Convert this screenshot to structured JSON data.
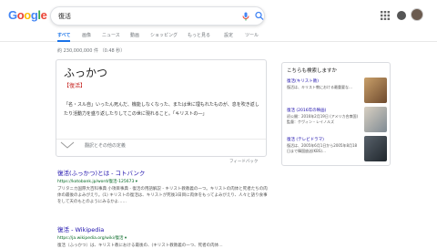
{
  "logo": {
    "text": "Google"
  },
  "search": {
    "value": "復活"
  },
  "tabs": [
    "すべて",
    "画像",
    "ニュース",
    "動画",
    "ショッピング",
    "もっと見る",
    "設定",
    "ツール"
  ],
  "stats": "約 230,000,000 件 （0.48 秒）",
  "dict": {
    "term": "ふっかつ",
    "tag": "【復活】",
    "definition": "「名・スル自」いったん死んだ、機能しなくなった、または世に埋もれたものが、息を吹き返したり活動力を盛り返したりしてこの世に現れること。「キリストの―」",
    "origin": "翻訳とその他の定義"
  },
  "feedback": "フィードバック",
  "results": [
    {
      "title": "復活(ふっかつ)とは - コトバンク",
      "url": "https://kotobank.jp/word/復活-125673 ▾",
      "snippet": "ブリタニカ国際大百科事典 小項目事典 - 復活の用語解説 - キリスト教教義の一つ。キリストの肉体と死者たちの肉体の最後のよみがえり。(1) キリストの復活は、キリストが死後3日目に肉体をもってよみがえり、人々と語り食事をして天のもとのようにみるかよ……"
    },
    {
      "title": "復活 - Wikipedia",
      "url": "https://ja.wikipedia.org/wiki/復活 ▾",
      "snippet": "復活（ふっかつ）は、キリスト教における最後の、(キリスト教教義の一つ、死者の肉体…"
    }
  ],
  "sidebar": {
    "heading": "こちらも検索しますか",
    "items": [
      {
        "title": "復活(キリスト教)",
        "text": "復活は、キリスト教における最重要な…",
        "thumb": "#8a6a4a"
      },
      {
        "title": "復活 (2016年の映画)",
        "text": "初公開：2016年2月19日 (アメリカ合衆国) 監督：ケヴィン・レイノルズ",
        "thumb": "#a0a4a8"
      },
      {
        "title": "復活 (テレビドラマ)",
        "text": "復活は、2005年6月1日から2005年8月18日まで韓国放送(KBS)…",
        "thumb": "#3b4650"
      }
    ]
  },
  "colors": {
    "link": "#1a0dab",
    "url": "#006621",
    "tag": "#c5221f",
    "accent": "#1a73e8"
  }
}
